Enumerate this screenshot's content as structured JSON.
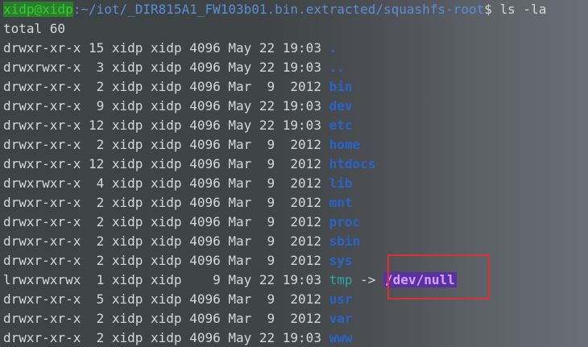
{
  "prompt": {
    "user_host": "xidp@xidp",
    "path": ":~/iot/_DIR815A1_FW103b01.bin.extracted/squashfs-root",
    "symbol": "$",
    "command": " ls -la"
  },
  "total": "total 60",
  "entries": [
    {
      "perm": "drwxr-xr-x",
      "links": "15",
      "user": "xidp",
      "group": "xidp",
      "size": "4096",
      "date": "May 22 19:03",
      "name": ".",
      "type": "dir"
    },
    {
      "perm": "drwxrwxr-x",
      "links": " 3",
      "user": "xidp",
      "group": "xidp",
      "size": "4096",
      "date": "May 22 19:03",
      "name": "..",
      "type": "dir"
    },
    {
      "perm": "drwxr-xr-x",
      "links": " 2",
      "user": "xidp",
      "group": "xidp",
      "size": "4096",
      "date": "Mar  9  2012",
      "name": "bin",
      "type": "dir"
    },
    {
      "perm": "drwxr-xr-x",
      "links": " 9",
      "user": "xidp",
      "group": "xidp",
      "size": "4096",
      "date": "May 22 19:03",
      "name": "dev",
      "type": "dir"
    },
    {
      "perm": "drwxr-xr-x",
      "links": "12",
      "user": "xidp",
      "group": "xidp",
      "size": "4096",
      "date": "May 22 19:03",
      "name": "etc",
      "type": "dir"
    },
    {
      "perm": "drwxr-xr-x",
      "links": " 2",
      "user": "xidp",
      "group": "xidp",
      "size": "4096",
      "date": "Mar  9  2012",
      "name": "home",
      "type": "dir"
    },
    {
      "perm": "drwxr-xr-x",
      "links": "12",
      "user": "xidp",
      "group": "xidp",
      "size": "4096",
      "date": "Mar  9  2012",
      "name": "htdocs",
      "type": "dir"
    },
    {
      "perm": "drwxrwxr-x",
      "links": " 4",
      "user": "xidp",
      "group": "xidp",
      "size": "4096",
      "date": "Mar  9  2012",
      "name": "lib",
      "type": "dir"
    },
    {
      "perm": "drwxr-xr-x",
      "links": " 2",
      "user": "xidp",
      "group": "xidp",
      "size": "4096",
      "date": "Mar  9  2012",
      "name": "mnt",
      "type": "dir"
    },
    {
      "perm": "drwxr-xr-x",
      "links": " 2",
      "user": "xidp",
      "group": "xidp",
      "size": "4096",
      "date": "Mar  9  2012",
      "name": "proc",
      "type": "dir"
    },
    {
      "perm": "drwxr-xr-x",
      "links": " 2",
      "user": "xidp",
      "group": "xidp",
      "size": "4096",
      "date": "Mar  9  2012",
      "name": "sbin",
      "type": "dir"
    },
    {
      "perm": "drwxr-xr-x",
      "links": " 2",
      "user": "xidp",
      "group": "xidp",
      "size": "4096",
      "date": "Mar  9  2012",
      "name": "sys",
      "type": "dir"
    },
    {
      "perm": "lrwxrwxrwx",
      "links": " 1",
      "user": "xidp",
      "group": "xidp",
      "size": "   9",
      "date": "May 22 19:03",
      "name": "tmp",
      "type": "link",
      "arrow": "->",
      "target": "/dev/null"
    },
    {
      "perm": "drwxr-xr-x",
      "links": " 5",
      "user": "xidp",
      "group": "xidp",
      "size": "4096",
      "date": "Mar  9  2012",
      "name": "usr",
      "type": "dir"
    },
    {
      "perm": "drwxr-xr-x",
      "links": " 2",
      "user": "xidp",
      "group": "xidp",
      "size": "4096",
      "date": "Mar  9  2012",
      "name": "var",
      "type": "dir"
    },
    {
      "perm": "drwxr-xr-x",
      "links": " 2",
      "user": "xidp",
      "group": "xidp",
      "size": "4096",
      "date": "May 22 19:03",
      "name": "www",
      "type": "dir"
    }
  ],
  "colors": {
    "background": "#3f4446",
    "text": "#d7d7d7",
    "directory": "#2a64c8",
    "symlink": "#2aa6a6",
    "highlight_border": "#e0302e",
    "null_target_bg": "#5a31a0"
  }
}
